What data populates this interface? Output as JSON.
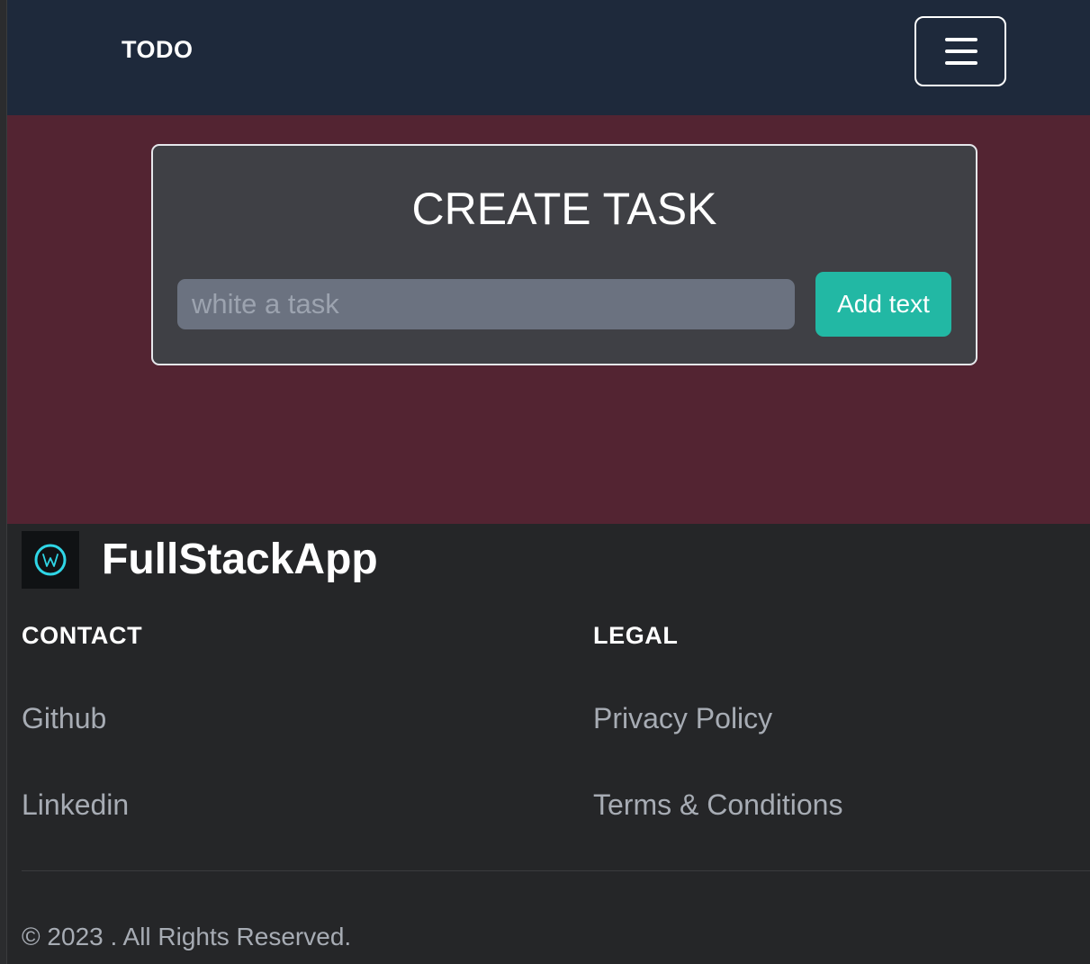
{
  "navbar": {
    "brand": "TODO",
    "menu_icon": "hamburger-menu-icon"
  },
  "create_task": {
    "title": "CREATE TASK",
    "input_placeholder": "white a task",
    "input_value": "",
    "add_button_label": "Add text"
  },
  "footer": {
    "logo_icon": "w-circle-logo-icon",
    "brand": "FullStackApp",
    "contact": {
      "heading": "CONTACT",
      "links": [
        "Github",
        "Linkedin"
      ]
    },
    "legal": {
      "heading": "LEGAL",
      "links": [
        "Privacy Policy",
        "Terms & Conditions"
      ]
    },
    "copyright": {
      "symbol": "©",
      "year": "2023",
      "text": ". All Rights Reserved."
    }
  },
  "colors": {
    "navbar_bg": "#1e293b",
    "main_bg": "#532432",
    "card_bg": "#3f4045",
    "input_bg": "#6b7280",
    "accent": "#22b8a4",
    "footer_bg": "#252628",
    "logo_glow": "#2fd6e6"
  }
}
